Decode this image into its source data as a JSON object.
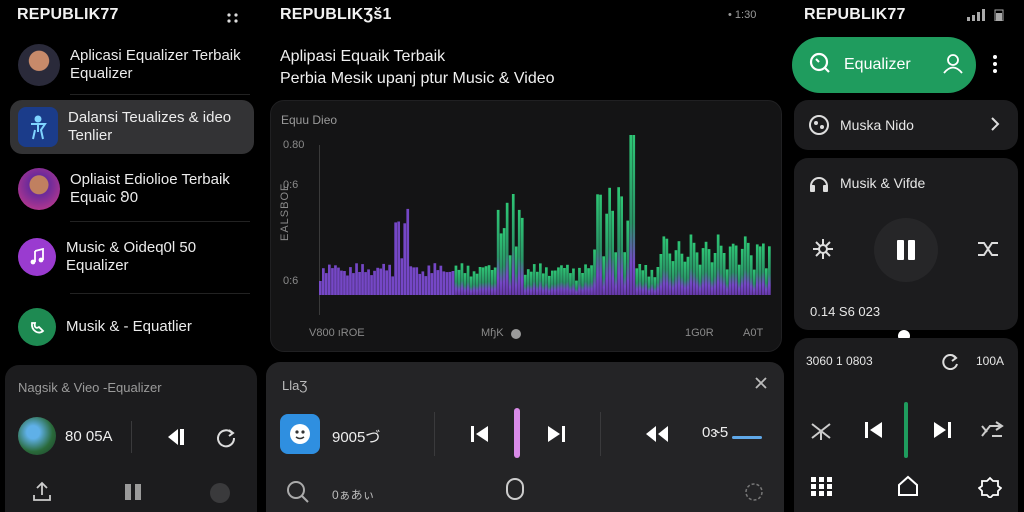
{
  "left": {
    "brand": "REPUBLIK77",
    "items": [
      {
        "label_line1": "Aplicasi Equalizer Terbaik",
        "label_line2": "Equalizer",
        "icon": "person-avatar"
      },
      {
        "label_line1": "Dalansi Teualizes & ideo",
        "label_line2": "Tenlier",
        "icon": "figure-app-icon"
      },
      {
        "label_line1": "Opliaist Ediolioe Terbaik",
        "label_line2": "Equaic 𐐂0",
        "icon": "person-avatar"
      },
      {
        "label_line1": "Music & Oideq0l 50",
        "label_line2": "Equalizer",
        "icon": "music-note-icon"
      },
      {
        "label_line1": "Musik & - Equatlier",
        "label_line2": "",
        "icon": "music-app-icon"
      }
    ],
    "mini": {
      "title": "Nagsik & Vieo -Equalizer",
      "time": "80 05A"
    }
  },
  "mid": {
    "brand": "REPUBLIKƷš1",
    "status": "• 1:30",
    "subtitle_line1": "Aplipasi Equaik Terbaik",
    "subtitle_line2": "Perbia Mesik upanj ptur Music & Video",
    "viz": {
      "title": "Equu Dieo",
      "y_ticks": [
        "0.80",
        "0:6",
        "0:6"
      ],
      "y_label": "EALSBOE",
      "x_labels": [
        "V800 ıROE",
        "MɧK",
        "1G0R",
        "A0T"
      ]
    },
    "player": {
      "title": "LlaƷ",
      "time": "9005づ",
      "progress_label": "0ɝ5",
      "search_label": "0ぁあぃ"
    }
  },
  "right": {
    "brand": "REPUBLIK77",
    "eq_label": "Equalizer",
    "row1": "Muska Nido",
    "row2": "Musik & Vifde",
    "time": "0.14 S6 023",
    "meta": "3060 1 0803",
    "meta2": "100A"
  },
  "colors": {
    "accent_green": "#1f9c5e",
    "purple": "#a85ee8",
    "pink": "#d98be8"
  }
}
